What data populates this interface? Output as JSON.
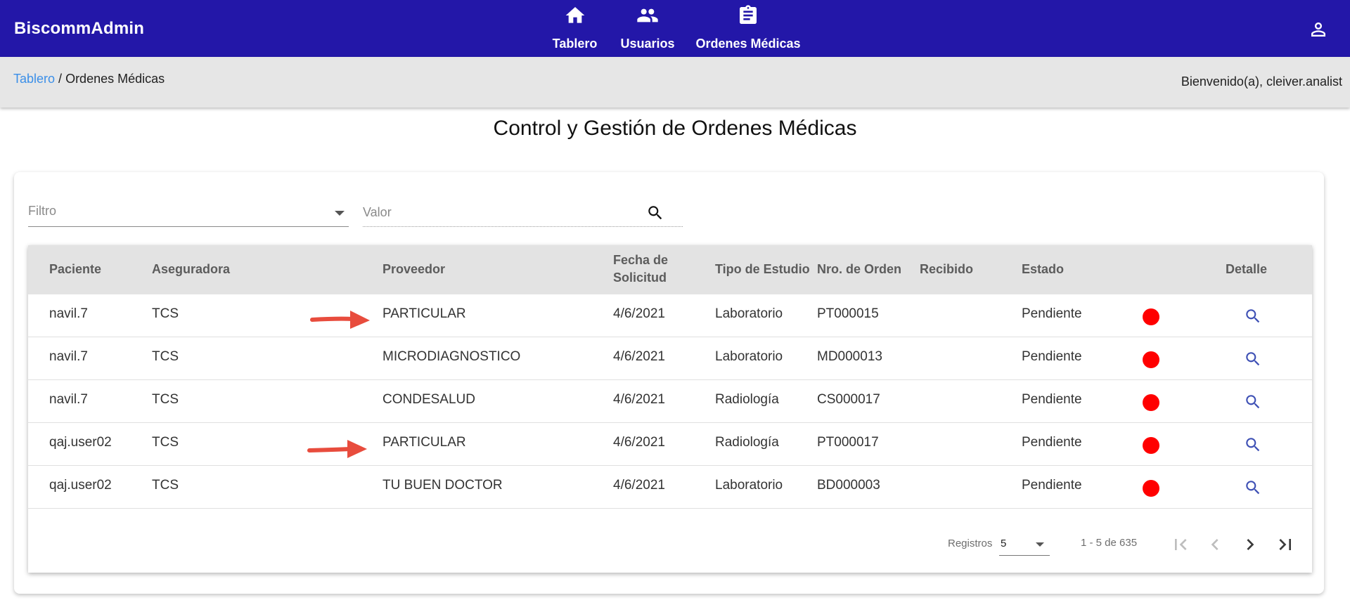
{
  "app": {
    "brand": "BiscommAdmin"
  },
  "nav": [
    {
      "label": "Tablero",
      "icon": "home-icon"
    },
    {
      "label": "Usuarios",
      "icon": "people-icon"
    },
    {
      "label": "Ordenes Médicas",
      "icon": "clipboard-icon"
    }
  ],
  "account": {
    "icon": "person-icon"
  },
  "breadcrumb": {
    "link": "Tablero",
    "separator": " / ",
    "current": "Ordenes Médicas"
  },
  "welcome": "Bienvenido(a), cleiver.analist",
  "page_title": "Control y Gestión de Ordenes Médicas",
  "filters": {
    "filtro_placeholder": "Filtro",
    "valor_placeholder": "Valor"
  },
  "table": {
    "headers": {
      "paciente": "Paciente",
      "aseguradora": "Aseguradora",
      "proveedor": "Proveedor",
      "fecha_line1": "Fecha de",
      "fecha_line2": "Solicitud",
      "tipo": "Tipo de Estudio",
      "nro": "Nro. de Orden",
      "recibido": "Recibido",
      "estado": "Estado",
      "detalle": "Detalle"
    },
    "rows": [
      {
        "paciente": "navil.7",
        "aseguradora": "TCS",
        "proveedor": "PARTICULAR",
        "fecha": "4/6/2021",
        "tipo": "Laboratorio",
        "nro": "PT000015",
        "recibido": "",
        "estado": "Pendiente",
        "status_color": "#ff0000"
      },
      {
        "paciente": "navil.7",
        "aseguradora": "TCS",
        "proveedor": "MICRODIAGNOSTICO",
        "fecha": "4/6/2021",
        "tipo": "Laboratorio",
        "nro": "MD000013",
        "recibido": "",
        "estado": "Pendiente",
        "status_color": "#ff0000"
      },
      {
        "paciente": "navil.7",
        "aseguradora": "TCS",
        "proveedor": "CONDESALUD",
        "fecha": "4/6/2021",
        "tipo": "Radiología",
        "nro": "CS000017",
        "recibido": "",
        "estado": "Pendiente",
        "status_color": "#ff0000"
      },
      {
        "paciente": "qaj.user02",
        "aseguradora": "TCS",
        "proveedor": "PARTICULAR",
        "fecha": "4/6/2021",
        "tipo": "Radiología",
        "nro": "PT000017",
        "recibido": "",
        "estado": "Pendiente",
        "status_color": "#ff0000"
      },
      {
        "paciente": "qaj.user02",
        "aseguradora": "TCS",
        "proveedor": "TU BUEN DOCTOR",
        "fecha": "4/6/2021",
        "tipo": "Laboratorio",
        "nro": "BD000003",
        "recibido": "",
        "estado": "Pendiente",
        "status_color": "#ff0000"
      }
    ]
  },
  "paginator": {
    "label": "Registros",
    "page_size": "5",
    "range": "1 - 5 de 635"
  },
  "colors": {
    "topbar": "#2317a8",
    "link": "#3b8fe8",
    "status_pending": "#ff0000",
    "detail_icon": "#3f51b5",
    "annotation_arrow": "#e84c3d"
  }
}
